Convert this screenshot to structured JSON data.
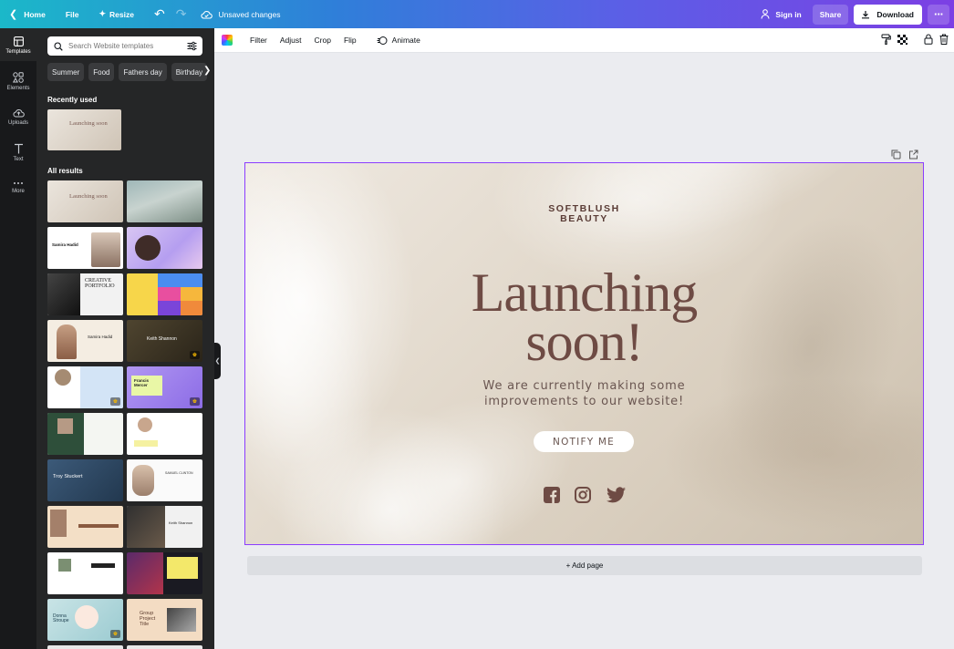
{
  "topbar": {
    "home_label": "Home",
    "file_label": "File",
    "resize_label": "Resize",
    "status_label": "Unsaved changes",
    "signin_label": "Sign in",
    "share_label": "Share",
    "download_label": "Download",
    "gradient_colors": [
      "#1bb8c9",
      "#2f7fd9",
      "#5b5fe6",
      "#7c3fe4"
    ]
  },
  "rail": {
    "items": [
      {
        "label": "Templates",
        "icon": "templates-icon",
        "active": true
      },
      {
        "label": "Elements",
        "icon": "elements-icon",
        "active": false
      },
      {
        "label": "Uploads",
        "icon": "uploads-icon",
        "active": false
      },
      {
        "label": "Text",
        "icon": "text-icon",
        "active": false
      },
      {
        "label": "More",
        "icon": "more-dots-icon",
        "active": false
      }
    ]
  },
  "panel": {
    "search_placeholder": "Search Website templates",
    "chips": [
      "Summer",
      "Food",
      "Fathers day",
      "Birthday"
    ],
    "recently_used_title": "Recently used",
    "all_results_title": "All results",
    "thumb_texts": {
      "launching": "Launching soon",
      "samira": "Samira Hadid",
      "creative": "CREATIVE PORTFOLIO",
      "keith": "Keith Shannon",
      "francis": "Francis Mercer",
      "troy": "Troy Stuckert",
      "samuel": "SAMUEL CLINTON",
      "donna": "Donna Stroupe",
      "group": "Group Project Title"
    }
  },
  "toolbar": {
    "filter_label": "Filter",
    "adjust_label": "Adjust",
    "crop_label": "Crop",
    "flip_label": "Flip",
    "animate_label": "Animate"
  },
  "design": {
    "brand_line1": "SOFTBLUSH",
    "brand_line2": "BEAUTY",
    "headline_line1": "Launching",
    "headline_line2": "soon!",
    "sub_line1": "We are currently making some",
    "sub_line2": "improvements to our website!",
    "cta_label": "NOTIFY ME",
    "text_color": "#6e4b44",
    "selection_color": "#8b3dff"
  },
  "add_page_label": "+ Add page"
}
